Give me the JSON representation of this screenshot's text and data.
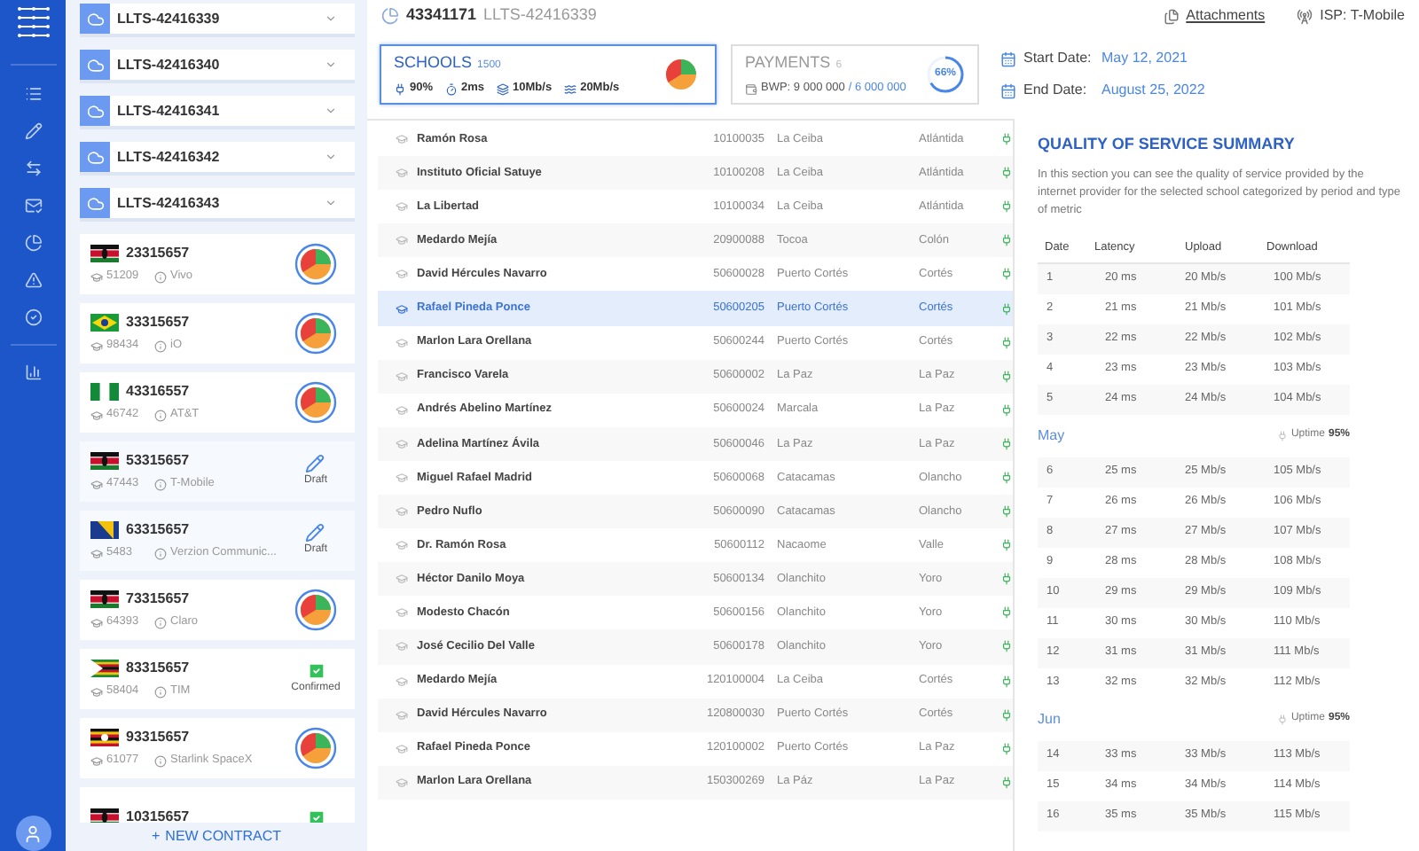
{
  "contracts_dropdowns": [
    {
      "label": "LLTS-42416339"
    },
    {
      "label": "LLTS-42416340"
    },
    {
      "label": "LLTS-42416341"
    },
    {
      "label": "LLTS-42416342"
    },
    {
      "label": "LLTS-42416343"
    }
  ],
  "contracts": [
    {
      "flag": {
        "kind": "kenya"
      },
      "id": "23315657",
      "schools": "51209",
      "isp": "Vivo",
      "kind": "pie"
    },
    {
      "flag": {
        "kind": "brazil"
      },
      "id": "33315657",
      "schools": "98434",
      "isp": "iO",
      "kind": "pie"
    },
    {
      "flag": {
        "kind": "nigeria"
      },
      "id": "43316557",
      "schools": "46742",
      "isp": "AT&T",
      "kind": "pie"
    },
    {
      "flag": {
        "kind": "kenya"
      },
      "id": "53315657",
      "schools": "47443",
      "isp": "T-Mobile",
      "kind": "draft",
      "status_label": "Draft"
    },
    {
      "flag": {
        "kind": "bosnia"
      },
      "id": "63315657",
      "schools": "5483",
      "isp": "Verzion Communic...",
      "kind": "draft",
      "status_label": "Draft"
    },
    {
      "flag": {
        "kind": "kenya"
      },
      "id": "73315657",
      "schools": "64393",
      "isp": "Claro",
      "kind": "pie"
    },
    {
      "flag": {
        "kind": "zimbabwe"
      },
      "id": "83315657",
      "schools": "58404",
      "isp": "TIM",
      "kind": "confirmed",
      "status_label": "Confirmed"
    },
    {
      "flag": {
        "kind": "uganda"
      },
      "id": "93315657",
      "schools": "61077",
      "isp": "Starlink SpaceX",
      "kind": "pie"
    },
    {
      "flag": {
        "kind": "kenya"
      },
      "id": "10315657",
      "kind": "confirmed"
    }
  ],
  "new_contract_button": {
    "icon": "+",
    "label": "NEW CONTRACT"
  },
  "header": {
    "contract_id": "43341171",
    "contract_code": "LLTS-42416339",
    "attachments_link": "Attachments",
    "isp": "ISP: T-Mobile"
  },
  "schools_card": {
    "title": "SCHOOLS",
    "count": "1500",
    "selected": true,
    "metrics": [
      "90%",
      "2ms",
      "10Mb/s",
      "20Mb/s"
    ]
  },
  "payments_card": {
    "title": "PAYMENTS",
    "count": "6",
    "selected": false,
    "amount": "BWP: 9 000 000",
    "total": "/ 6 000 000",
    "percent": "66%"
  },
  "dates": [
    {
      "label": "Start Date:",
      "value": "May 12, 2021"
    },
    {
      "label": "End Date:",
      "value": "August 25, 2022"
    }
  ],
  "schools": [
    {
      "name": "Ramón Rosa",
      "code": "10100035",
      "city": "La Ceiba",
      "department": "Atlántida",
      "selected": false
    },
    {
      "name": "Instituto Oficial Satuye",
      "code": "10100208",
      "city": "La Ceiba",
      "department": "Atlántida",
      "selected": false
    },
    {
      "name": "La Libertad",
      "code": "10100034",
      "city": "La Ceiba",
      "department": "Atlántida",
      "selected": false
    },
    {
      "name": "Medardo Mejía",
      "code": "20900088",
      "city": "Tocoa",
      "department": "Colón",
      "selected": false
    },
    {
      "name": "David Hércules Navarro",
      "code": "50600028",
      "city": "Puerto Cortés",
      "department": "Cortés",
      "selected": false
    },
    {
      "name": "Rafael Pineda Ponce",
      "code": "50600205",
      "city": "Puerto Cortés",
      "department": "Cortés",
      "selected": true
    },
    {
      "name": "Marlon Lara Orellana",
      "code": "50600244",
      "city": "Puerto Cortés",
      "department": "Cortés",
      "selected": false
    },
    {
      "name": "Francisco Varela",
      "code": "50600002",
      "city": "La Paz",
      "department": "La Paz",
      "selected": false
    },
    {
      "name": "Andrés Abelino Martínez",
      "code": "50600024",
      "city": "Marcala",
      "department": "La Paz",
      "selected": false
    },
    {
      "name": "Adelina Martínez Ávila",
      "code": "50600046",
      "city": "La Paz",
      "department": "La Paz",
      "selected": false
    },
    {
      "name": "Miguel Rafael Madrid",
      "code": "50600068",
      "city": "Catacamas",
      "department": "Olancho",
      "selected": false
    },
    {
      "name": "Pedro Nuflo",
      "code": "50600090",
      "city": "Catacamas",
      "department": "Olancho",
      "selected": false
    },
    {
      "name": "Dr. Ramón Rosa",
      "code": "50600112",
      "city": "Nacaome",
      "department": "Valle",
      "selected": false
    },
    {
      "name": "Héctor Danilo Moya",
      "code": "50600134",
      "city": "Olanchito",
      "department": "Yoro",
      "selected": false
    },
    {
      "name": "Modesto Chacón",
      "code": "50600156",
      "city": "Olanchito",
      "department": "Yoro",
      "selected": false
    },
    {
      "name": "José Cecilio Del Valle",
      "code": "50600178",
      "city": "Olanchito",
      "department": "Yoro",
      "selected": false
    },
    {
      "name": "Medardo Mejía",
      "code": "120100004",
      "city": "La Ceiba",
      "department": "Cortés",
      "selected": false
    },
    {
      "name": "David Hércules Navarro",
      "code": "120800030",
      "city": "Puerto Cortés",
      "department": "Cortés",
      "selected": false
    },
    {
      "name": "Rafael Pineda Ponce",
      "code": "120100002",
      "city": "Puerto Cortés",
      "department": "La Paz",
      "selected": false
    },
    {
      "name": "Marlon Lara Orellana",
      "code": "150300269",
      "city": "La Páz",
      "department": "La Paz",
      "selected": false
    }
  ],
  "qos": {
    "title": "QUALITY OF SERVICE SUMMARY",
    "description": "In this section you can see the quality of service provided by the internet provider for the selected school categorized by period and type of metric",
    "columns": [
      "Date",
      "Latency",
      "Upload",
      "Download"
    ],
    "groups": [
      {
        "rows": [
          [
            "1",
            "20 ms",
            "20 Mb/s",
            "100 Mb/s"
          ],
          [
            "2",
            "21 ms",
            "21 Mb/s",
            "101 Mb/s"
          ],
          [
            "3",
            "22 ms",
            "22 Mb/s",
            "102 Mb/s"
          ],
          [
            "4",
            "23 ms",
            "23 Mb/s",
            "103 Mb/s"
          ],
          [
            "5",
            "24 ms",
            "24 Mb/s",
            "104 Mb/s"
          ]
        ]
      },
      {
        "month": "May",
        "uptime_label": "Uptime",
        "uptime": "95%",
        "rows": [
          [
            "6",
            "25 ms",
            "25 Mb/s",
            "105 Mb/s"
          ],
          [
            "7",
            "26 ms",
            "26 Mb/s",
            "106 Mb/s"
          ],
          [
            "8",
            "27 ms",
            "27 Mb/s",
            "107 Mb/s"
          ],
          [
            "9",
            "28 ms",
            "28 Mb/s",
            "108 Mb/s"
          ],
          [
            "10",
            "29 ms",
            "29 Mb/s",
            "109 Mb/s"
          ],
          [
            "11",
            "30 ms",
            "30 Mb/s",
            "110 Mb/s"
          ],
          [
            "12",
            "31 ms",
            "31 Mb/s",
            "111 Mb/s"
          ],
          [
            "13",
            "32 ms",
            "32 Mb/s",
            "112 Mb/s"
          ]
        ]
      },
      {
        "month": "Jun",
        "uptime_label": "Uptime",
        "uptime": "95%",
        "rows": [
          [
            "14",
            "33 ms",
            "33 Mb/s",
            "113 Mb/s"
          ],
          [
            "15",
            "34 ms",
            "34 Mb/s",
            "114 Mb/s"
          ],
          [
            "16",
            "35 ms",
            "35 Mb/s",
            "115 Mb/s"
          ]
        ]
      }
    ]
  }
}
